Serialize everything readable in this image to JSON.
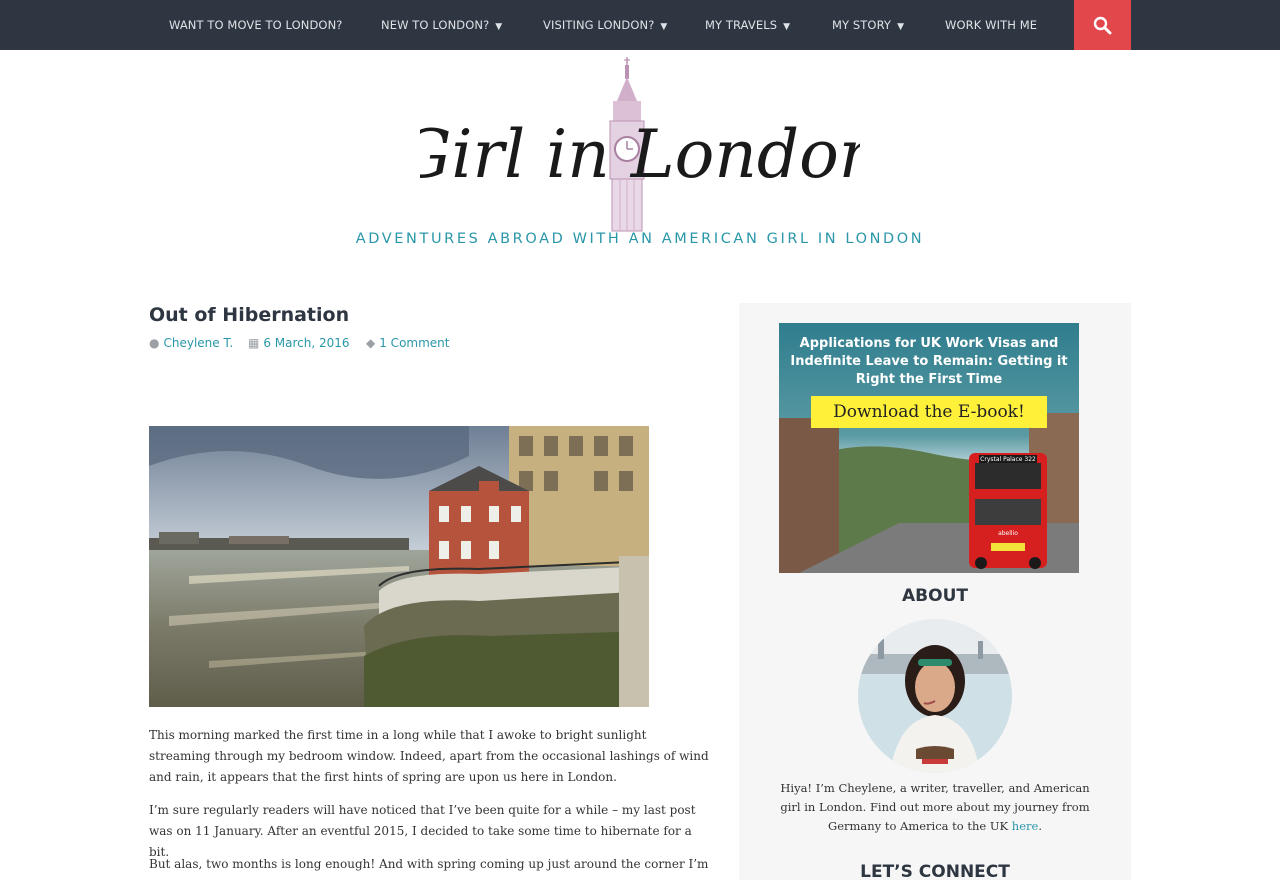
{
  "nav": {
    "items": [
      {
        "label": "WANT TO MOVE TO LONDON?",
        "has_dropdown": false
      },
      {
        "label": "NEW TO LONDON?",
        "has_dropdown": true
      },
      {
        "label": "VISITING LONDON?",
        "has_dropdown": true
      },
      {
        "label": "MY TRAVELS",
        "has_dropdown": true
      },
      {
        "label": "MY STORY",
        "has_dropdown": true
      },
      {
        "label": "WORK WITH ME",
        "has_dropdown": false
      }
    ],
    "search_icon": "search-icon",
    "caret_icon": "caret-down-icon"
  },
  "header": {
    "logo_text": "Girl in London",
    "tagline": "ADVENTURES ABROAD WITH AN AMERICAN GIRL IN LONDON"
  },
  "post": {
    "title": "Out of Hibernation",
    "author": "Cheylene T.",
    "date": "6 March, 2016",
    "comments": "1 Comment",
    "paragraphs": [
      "This morning marked the first time in a long while that I awoke to bright sunlight streaming through my bedroom window. Indeed, apart from the occasional lashings of wind and rain, it appears that the first hints of spring are upon us here in London.",
      "I’m sure regularly readers will have noticed that I’ve been quite for a while – my last post was on 11 January. After an eventful 2015, I decided to take some time to hibernate for a bit.",
      "But alas, two months is long enough! And with spring coming up just around the corner I’m"
    ]
  },
  "sidebar": {
    "ad": {
      "headline": "Applications for UK Work Visas and Indefinite Leave to Remain: Getting it Right the First Time",
      "cta": "Download the E-book!",
      "bus_route": "Crystal Palace  322",
      "bus_brand": "abellio"
    },
    "about": {
      "heading": "ABOUT",
      "text_before_link": "Hiya! I’m Cheylene, a writer, traveller, and American girl in London. Find out more about my journey from Germany to America to the UK ",
      "link_text": "here",
      "text_after_link": "."
    },
    "connect": {
      "heading": "LET’S CONNECT"
    }
  },
  "colors": {
    "nav_bg": "#2e3641",
    "accent_red": "#e2474c",
    "accent_teal": "#2a97a9",
    "sidebar_bg": "#f6f6f6"
  }
}
